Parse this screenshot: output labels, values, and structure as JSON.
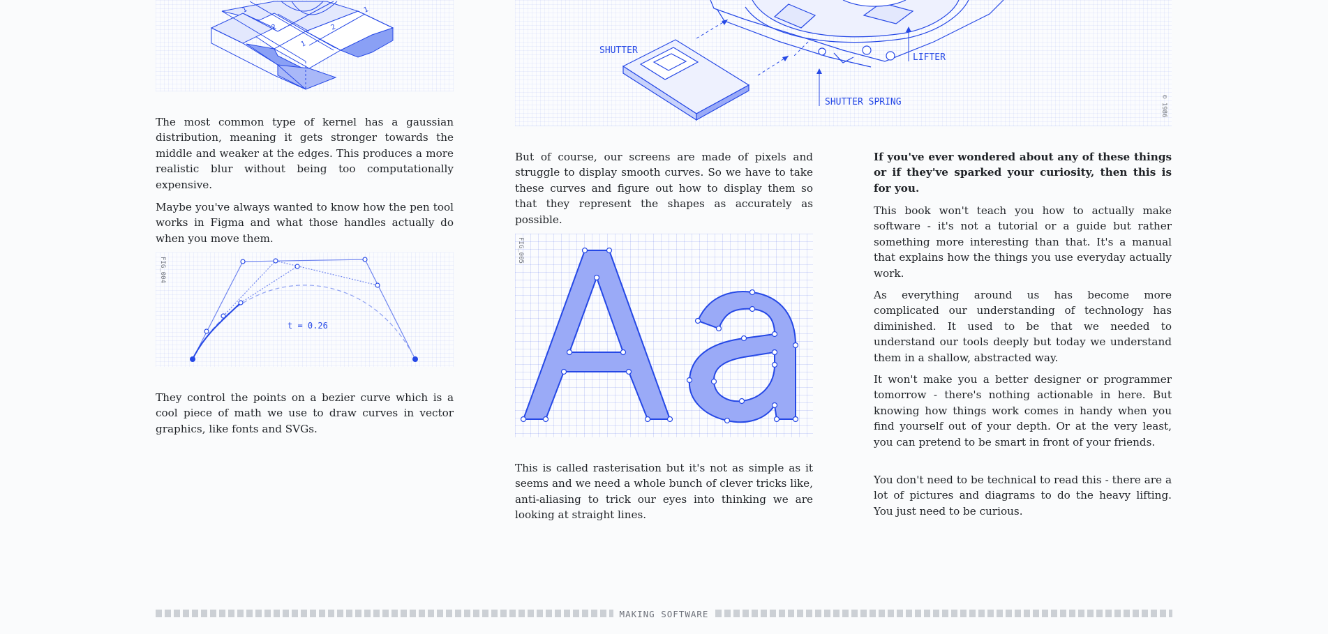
{
  "left": {
    "p1": "The most common type of kernel has a gaussian distribution, meaning it gets stronger towards the middle and weaker at the edges. This produces a more realistic blur without being too computationally expensive.",
    "p2": "Maybe you've always wanted to know how the pen tool works in Figma and what those handles actually do when you move them.",
    "fig_label": "FIG_004",
    "t_label": "t = 0.26",
    "p3": "They control the points on a bezier curve which is a cool piece of math we use to draw curves in vector graphics, like fonts and SVGs.",
    "grid_numbers": [
      "1",
      "2",
      "2",
      "1",
      "1"
    ]
  },
  "middle": {
    "labels": {
      "shutter": "SHUTTER",
      "lifter": "LIFTER",
      "shutter_spring": "SHUTTER SPRING",
      "year": "© 1986"
    },
    "p1": "But of course, our screens are made of pixels and struggle to display smooth curves. So we have to take these curves and figure out how to display them so that they represent the shapes as accurately as possible.",
    "fig_label": "FIG_005",
    "glyphs": "Aa",
    "p2": "This is called rasterisation but it's not as simple as it seems and we need a whole bunch of clever tricks like, anti-aliasing to trick our eyes into thinking we are looking at straight lines."
  },
  "right": {
    "p1": "If you've ever wondered about any of these things or if they've sparked your curiosity, then this is for you.",
    "p2": "This book won't teach you how to actually make software - it's not a tutorial or a guide but rather something more interesting than that. It's a manual that explains how the things you use everyday actually work.",
    "p3": "As everything around us has become more complicated our understanding of technology has diminished. It used to be that we needed to understand our tools deeply but today we understand them in a shallow, abstracted way.",
    "p4": "It won't make you a better designer or programmer tomorrow - there's nothing actionable in here. But knowing how things work comes in handy when you find yourself out of your depth. Or at the very least, you can pretend to be smart in front of your friends.",
    "p5": "You don't need to be technical to read this - there are a lot of pictures and diagrams to do the heavy lifting. You just need to be curious."
  },
  "footer": {
    "title": "MAKING SOFTWARE"
  },
  "colors": {
    "accent": "#2548e6",
    "fill": "#9aaaf7",
    "text": "#1f2226"
  }
}
